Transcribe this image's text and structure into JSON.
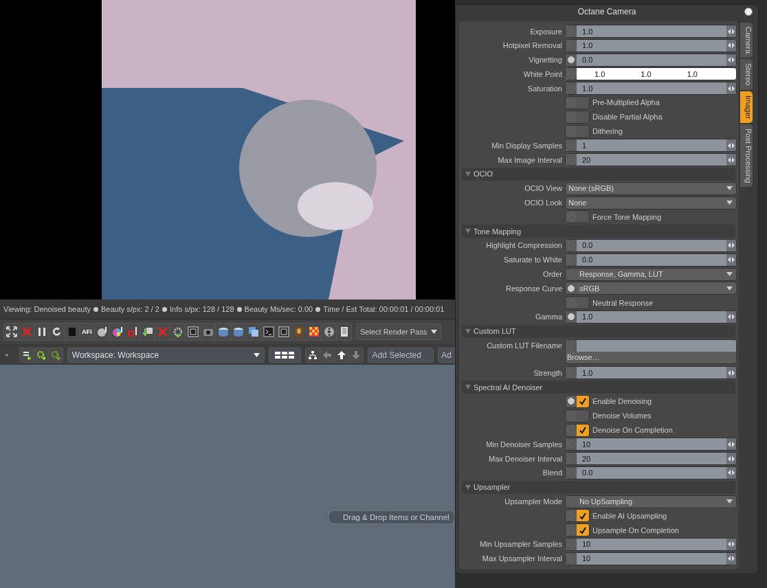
{
  "viewer": {
    "status": [
      "Viewing: Denoised beauty",
      "Beauty s/px: 2 / 2",
      "Info s/px: 128 / 128",
      "Beauty Ms/sec: 0.00",
      "Time / Est Total: 00:00:01 / 00:00:01"
    ]
  },
  "render_toolbar": {
    "afi_label": "AFI",
    "render_pass": "Select Render Pass"
  },
  "workspace_bar": {
    "workspace": "Workspace: Workspace",
    "add_selected": "Add Selected",
    "add_cut": "Ad"
  },
  "drop_hint": "Drag & Drop Items or Channel",
  "panel": {
    "title": "Octane Camera",
    "tabs": [
      {
        "label": "Camera",
        "selected": false
      },
      {
        "label": "Stereo",
        "selected": false
      },
      {
        "label": "Imager",
        "selected": true
      },
      {
        "label": "Post Processing",
        "selected": false
      }
    ],
    "rows": [
      {
        "kind": "number",
        "label": "Exposure",
        "value": "1.0",
        "keyed": false
      },
      {
        "kind": "number",
        "label": "Hotpixel Removal",
        "value": "1.0",
        "keyed": false
      },
      {
        "kind": "number",
        "label": "Vignetting",
        "value": "0.0",
        "keyed": true
      },
      {
        "kind": "color",
        "label": "White Point",
        "values": [
          "1.0",
          "1.0",
          "1.0"
        ],
        "keyed": false
      },
      {
        "kind": "number",
        "label": "Saturation",
        "value": "1.0",
        "keyed": false
      },
      {
        "kind": "checkbox",
        "label": "Pre-Multiplied Alpha",
        "checked": false,
        "keyed": false
      },
      {
        "kind": "checkbox",
        "label": "Disable Partial Alpha",
        "checked": false,
        "keyed": false
      },
      {
        "kind": "checkbox",
        "label": "Dithering",
        "checked": false,
        "keyed": false
      },
      {
        "kind": "number",
        "label": "Min Display Samples",
        "value": "1",
        "keyed": false
      },
      {
        "kind": "number",
        "label": "Max Image Interval",
        "value": "20",
        "keyed": false
      },
      {
        "kind": "section",
        "label": "OCIO",
        "expanded": true
      },
      {
        "kind": "menu",
        "label": "OCIO View",
        "value": "None (sRGB)"
      },
      {
        "kind": "menu",
        "label": "OCIO Look",
        "value": "None"
      },
      {
        "kind": "checkbox",
        "label": "Force Tone Mapping",
        "checked": false,
        "keyed": false
      },
      {
        "kind": "section",
        "label": "Tone Mapping",
        "expanded": true
      },
      {
        "kind": "number",
        "label": "Highlight Compression",
        "value": "0.0",
        "keyed": false
      },
      {
        "kind": "number",
        "label": "Saturate to White",
        "value": "0.0",
        "keyed": false
      },
      {
        "kind": "dropdown",
        "label": "Order",
        "value": "Response, Gamma, LUT",
        "keyed": false
      },
      {
        "kind": "dropdown",
        "label": "Response Curve",
        "value": "sRGB",
        "keyed": true
      },
      {
        "kind": "checkbox",
        "label": "Neutral Response",
        "checked": false,
        "keyed": false
      },
      {
        "kind": "number",
        "label": "Gamma",
        "value": "1.0",
        "keyed": true
      },
      {
        "kind": "section",
        "label": "Custom LUT",
        "expanded": true
      },
      {
        "kind": "file",
        "label": "Custom LUT Filename",
        "button": "Browse…"
      },
      {
        "kind": "number",
        "label": "Strength",
        "value": "1.0",
        "keyed": false
      },
      {
        "kind": "section",
        "label": "Spectral AI Denoiser",
        "expanded": true
      },
      {
        "kind": "checkbox",
        "label": "Enable Denoising",
        "checked": true,
        "keyed": true
      },
      {
        "kind": "checkbox",
        "label": "Denoise Volumes",
        "checked": false,
        "keyed": false
      },
      {
        "kind": "checkbox",
        "label": "Denoise On Completion",
        "checked": true,
        "keyed": false
      },
      {
        "kind": "number",
        "label": "Min Denoiser Samples",
        "value": "10",
        "keyed": false
      },
      {
        "kind": "number",
        "label": "Max Denoiser Interval",
        "value": "20",
        "keyed": false
      },
      {
        "kind": "number",
        "label": "Blend",
        "value": "0.0",
        "keyed": false
      },
      {
        "kind": "section",
        "label": "Upsampler",
        "expanded": true
      },
      {
        "kind": "dropdown",
        "label": "Upsampler Mode",
        "value": "No UpSampling",
        "keyed": false
      },
      {
        "kind": "checkbox",
        "label": "Enable AI Upsampling",
        "checked": true,
        "keyed": false
      },
      {
        "kind": "checkbox",
        "label": "Upsample On Completion",
        "checked": true,
        "keyed": false
      },
      {
        "kind": "number",
        "label": "Min Upsampler Samples",
        "value": "10",
        "keyed": false
      },
      {
        "kind": "number",
        "label": "Max Upsampler Interval",
        "value": "10",
        "keyed": false
      }
    ]
  }
}
